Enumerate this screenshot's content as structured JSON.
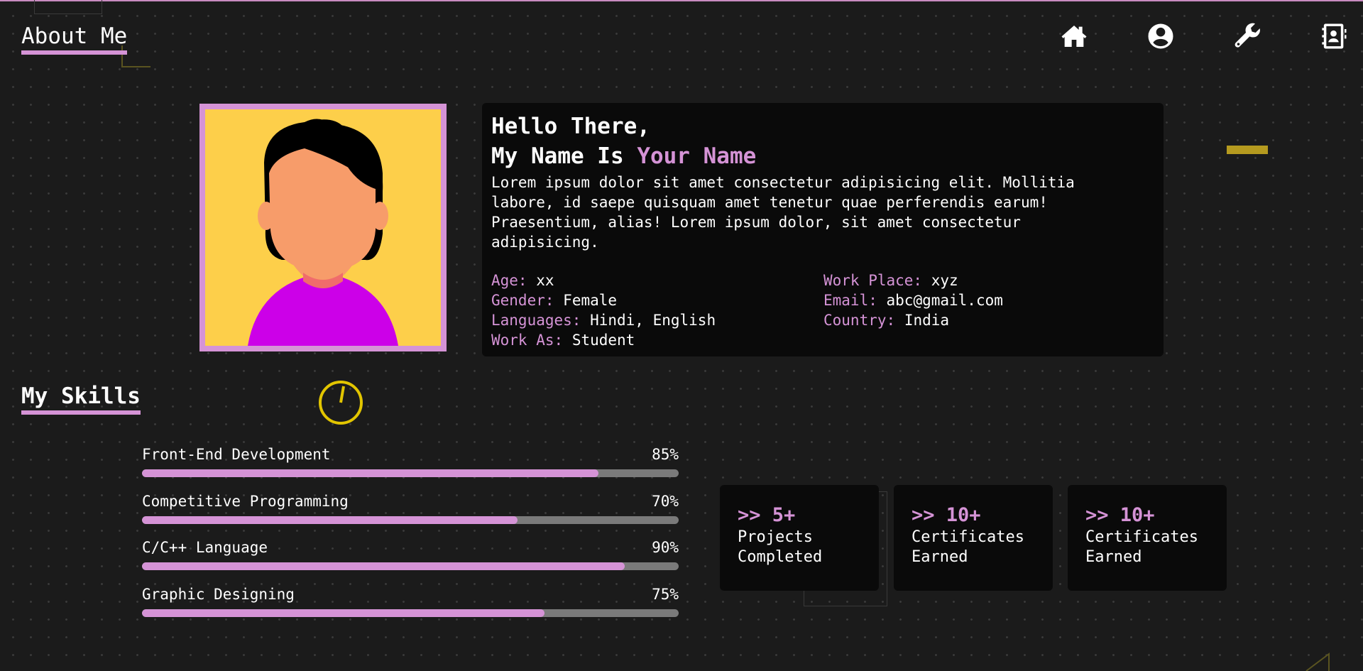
{
  "nav": {
    "title": "About Me",
    "icons": [
      "home-icon",
      "user-circle-icon",
      "wrench-icon",
      "contact-book-icon"
    ]
  },
  "profile": {
    "greeting_line1": "Hello There,",
    "greeting_prefix": "My Name Is",
    "name": "Your Name",
    "bio": "Lorem ipsum dolor sit amet consectetur adipisicing elit. Mollitia labore, id saepe quisquam amet tenetur quae perferendis earum! Praesentium, alias! Lorem ipsum dolor, sit amet consectetur adipisicing.",
    "details": [
      {
        "label": "Age:",
        "value": "xx"
      },
      {
        "label": "Work Place:",
        "value": "xyz"
      },
      {
        "label": "Gender:",
        "value": "Female"
      },
      {
        "label": "Email:",
        "value": "abc@gmail.com"
      },
      {
        "label": "Languages:",
        "value": "Hindi, English"
      },
      {
        "label": "Country:",
        "value": "India"
      },
      {
        "label": "Work As:",
        "value": "Student"
      }
    ]
  },
  "skills": {
    "title": "My Skills",
    "items": [
      {
        "name": "Front-End Development",
        "percent_label": "85%",
        "percent": 85
      },
      {
        "name": "Competitive Programming",
        "percent_label": "70%",
        "percent": 70
      },
      {
        "name": "C/C++ Language",
        "percent_label": "90%",
        "percent": 90
      },
      {
        "name": "Graphic Designing",
        "percent_label": "75%",
        "percent": 75
      }
    ]
  },
  "stats": [
    {
      "value": ">> 5+",
      "line1": "Projects",
      "line2": "Completed"
    },
    {
      "value": ">> 10+",
      "line1": "Certificates",
      "line2": "Earned"
    },
    {
      "value": ">> 10+",
      "line1": "Certificates",
      "line2": "Earned"
    }
  ],
  "colors": {
    "accent": "#d593d6",
    "background": "#1b1b1b",
    "card": "#0a0a0a",
    "photo_bg": "#fdcf4a",
    "track": "#7a7a7a"
  }
}
